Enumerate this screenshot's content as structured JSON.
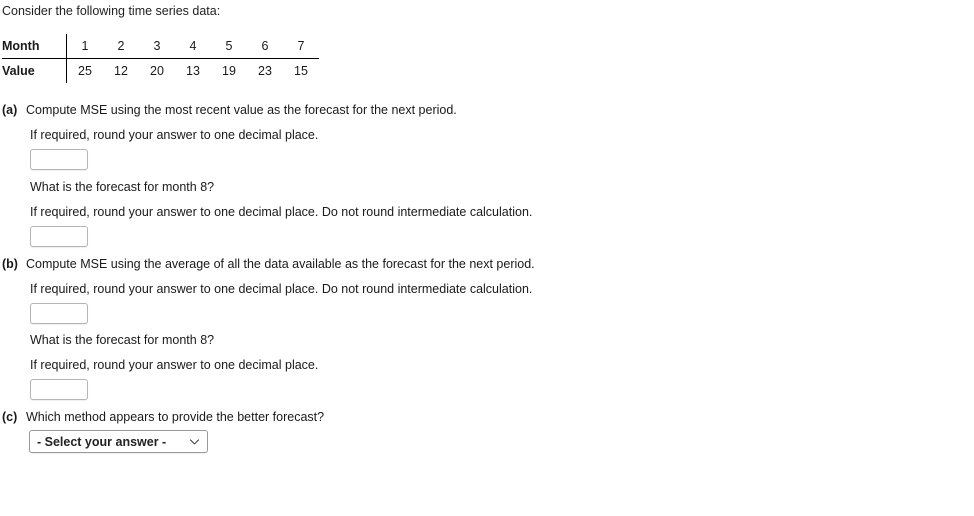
{
  "intro": {
    "text": "Consider the following time series data:"
  },
  "table": {
    "row_headers": [
      "Month",
      "Value"
    ],
    "months": [
      "1",
      "2",
      "3",
      "4",
      "5",
      "6",
      "7"
    ],
    "values": [
      "25",
      "12",
      "20",
      "13",
      "19",
      "23",
      "15"
    ]
  },
  "questions": [
    {
      "label": "(a)",
      "text": "Compute MSE using the most recent value as the forecast for the next period.",
      "hint1": "If required, round your answer to one decimal place.",
      "answer1": "",
      "prompt2": "What is the forecast for month 8?",
      "hint2": "If required, round your answer to one decimal place. Do not round intermediate calculation.",
      "answer2": ""
    },
    {
      "label": "(b)",
      "text": "Compute MSE using the average of all the data available as the forecast for the next period.",
      "hint1": "If required, round your answer to one decimal place. Do not round intermediate calculation.",
      "answer1": "",
      "prompt2": "What is the forecast for month 8?",
      "hint2": "If required, round your answer to one decimal place.",
      "answer2": ""
    },
    {
      "label": "(c)",
      "text": "Which method appears to provide the better forecast?",
      "select_value": "- Select your answer -"
    }
  ],
  "colors": {
    "text": "#1a1a1a",
    "rule": "#000000",
    "input_border": "#b5b5b5",
    "select_border": "#9a9a9a"
  }
}
